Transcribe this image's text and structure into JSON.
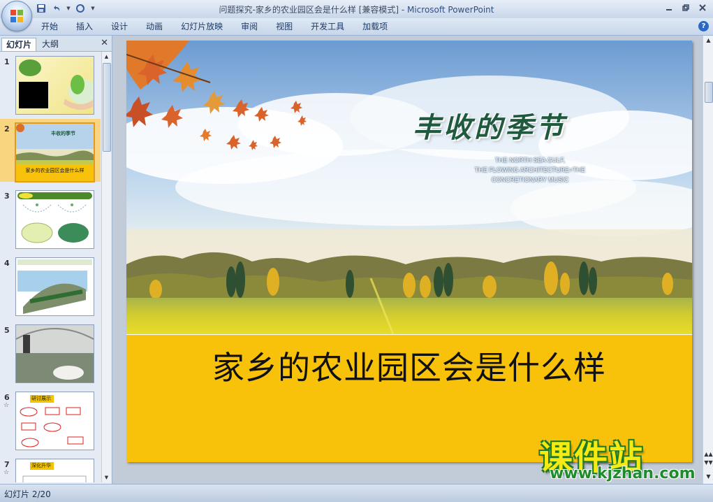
{
  "window": {
    "title": "问题探究-家乡的农业园区会是什么样 [兼容模式] - ",
    "app_name": "Microsoft PowerPoint"
  },
  "ribbon": {
    "tabs": [
      "开始",
      "插入",
      "设计",
      "动画",
      "幻灯片放映",
      "审阅",
      "视图",
      "开发工具",
      "加载项"
    ]
  },
  "left_pane": {
    "tab_slides": "幻灯片",
    "tab_outline": "大纲",
    "thumbnails": [
      {
        "num": "1"
      },
      {
        "num": "2",
        "caption": "家乡的农业园区会是什么样",
        "title_art": "丰收的季节"
      },
      {
        "num": "3"
      },
      {
        "num": "4"
      },
      {
        "num": "5"
      },
      {
        "num": "6",
        "star": "☆",
        "label": "研讨展示"
      },
      {
        "num": "7",
        "star": "☆",
        "label": "深化升华"
      }
    ]
  },
  "slide": {
    "title_art": "丰收的季节",
    "subtitle_lines": [
      "THE NORTH SEA GULF,",
      "THE FLOWING ARCHITECTURE=THE",
      "CONCRETIONARY MUSIC"
    ],
    "main_title": "家乡的农业园区会是什么样"
  },
  "watermark": {
    "big": "课件站",
    "small": "www.kjzhan.com"
  },
  "status": {
    "slide_counter": "幻灯片 2/20"
  },
  "colors": {
    "band_yellow": "#f9c20a",
    "title_green": "#1f5a3f",
    "selected_thumb": "#f9d580"
  }
}
